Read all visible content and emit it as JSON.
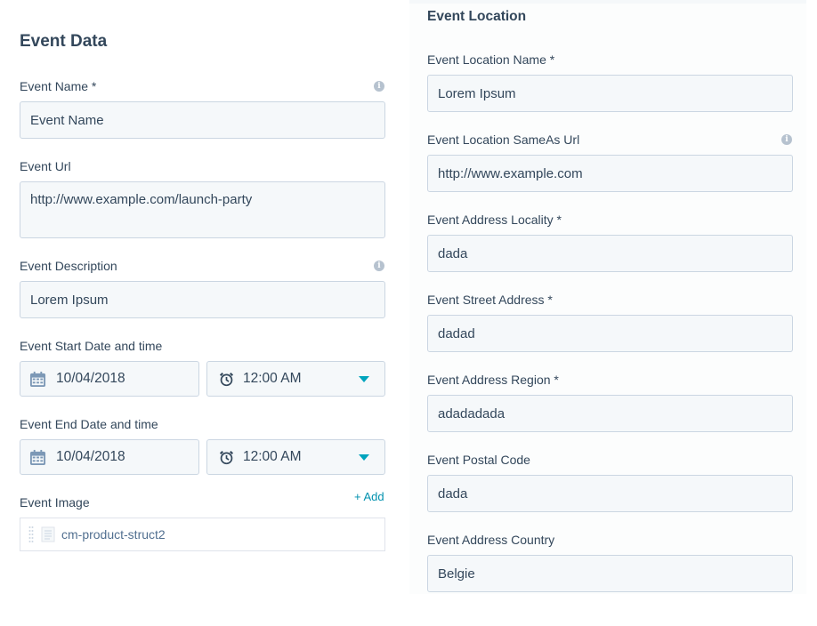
{
  "event_data": {
    "title": "Event Data",
    "name": {
      "label": "Event Name *",
      "value": "Event Name"
    },
    "url": {
      "label": "Event Url",
      "value": "http://www.example.com/launch-party"
    },
    "description": {
      "label": "Event Description",
      "value": "Lorem Ipsum"
    },
    "start": {
      "label": "Event Start Date and time",
      "date": "10/04/2018",
      "time": "12:00 AM"
    },
    "end": {
      "label": "Event End Date and time",
      "date": "10/04/2018",
      "time": "12:00 AM"
    },
    "image": {
      "label": "Event Image",
      "add_label": "+ Add",
      "item_name": "cm-product-struct2"
    }
  },
  "event_location": {
    "title": "Event Location",
    "fields": [
      {
        "label": "Event Location Name *",
        "value": "Lorem Ipsum"
      },
      {
        "label": "Event Location SameAs Url",
        "value": "http://www.example.com"
      },
      {
        "label": "Event Address Locality *",
        "value": "dada"
      },
      {
        "label": "Event Street Address *",
        "value": "dadad"
      },
      {
        "label": "Event Address Region *",
        "value": "adadadada"
      },
      {
        "label": "Event Postal Code",
        "value": "dada"
      },
      {
        "label": "Event Address Country",
        "value": "Belgie"
      }
    ]
  },
  "icons": {
    "info": "info-icon",
    "calendar": "calendar-icon",
    "alarm": "alarm-clock-icon",
    "caret": "chevron-down-icon",
    "drag": "drag-handle-icon",
    "image": "image-icon"
  },
  "colors": {
    "text": "#33475b",
    "field_bg": "#f5f8fa",
    "field_border": "#cbd6e2",
    "accent": "#00a4bd",
    "link": "#0091ae"
  }
}
